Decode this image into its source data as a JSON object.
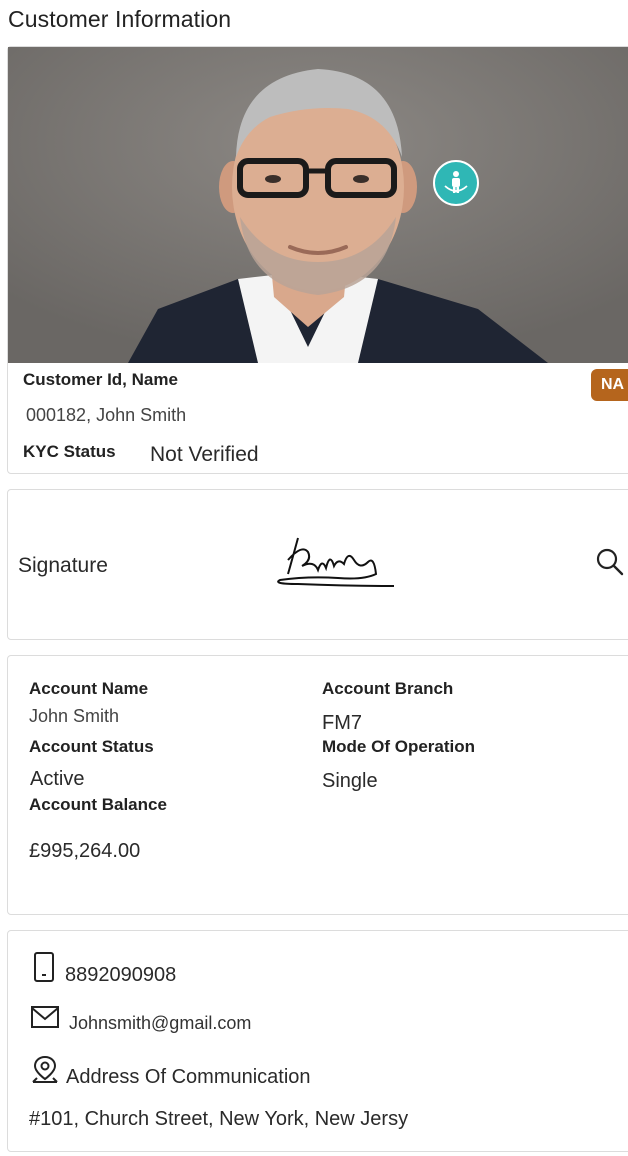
{
  "header": {
    "title": "Customer Information"
  },
  "customer": {
    "id_name_label": "Customer Id, Name",
    "id_name_value": "000182, John Smith",
    "kyc_label": "KYC Status",
    "kyc_value": "Not Verified",
    "badge": "NA"
  },
  "signature": {
    "label": "Signature"
  },
  "account": {
    "name_label": "Account Name",
    "name_value": "John Smith",
    "branch_label": "Account Branch",
    "branch_value": "FM7",
    "status_label": "Account Status",
    "status_value": "Active",
    "mode_label": "Mode Of Operation",
    "mode_value": "Single",
    "balance_label": "Account Balance",
    "balance_value": "£995,264.00"
  },
  "contact": {
    "phone": "8892090908",
    "email": "Johnsmith@gmail.com",
    "address_label": "Address Of Communication",
    "address_value": "#101, Church Street, New York, New Jersy"
  },
  "colors": {
    "accent_teal": "#2fb7b5",
    "badge_brown": "#b5651d"
  }
}
